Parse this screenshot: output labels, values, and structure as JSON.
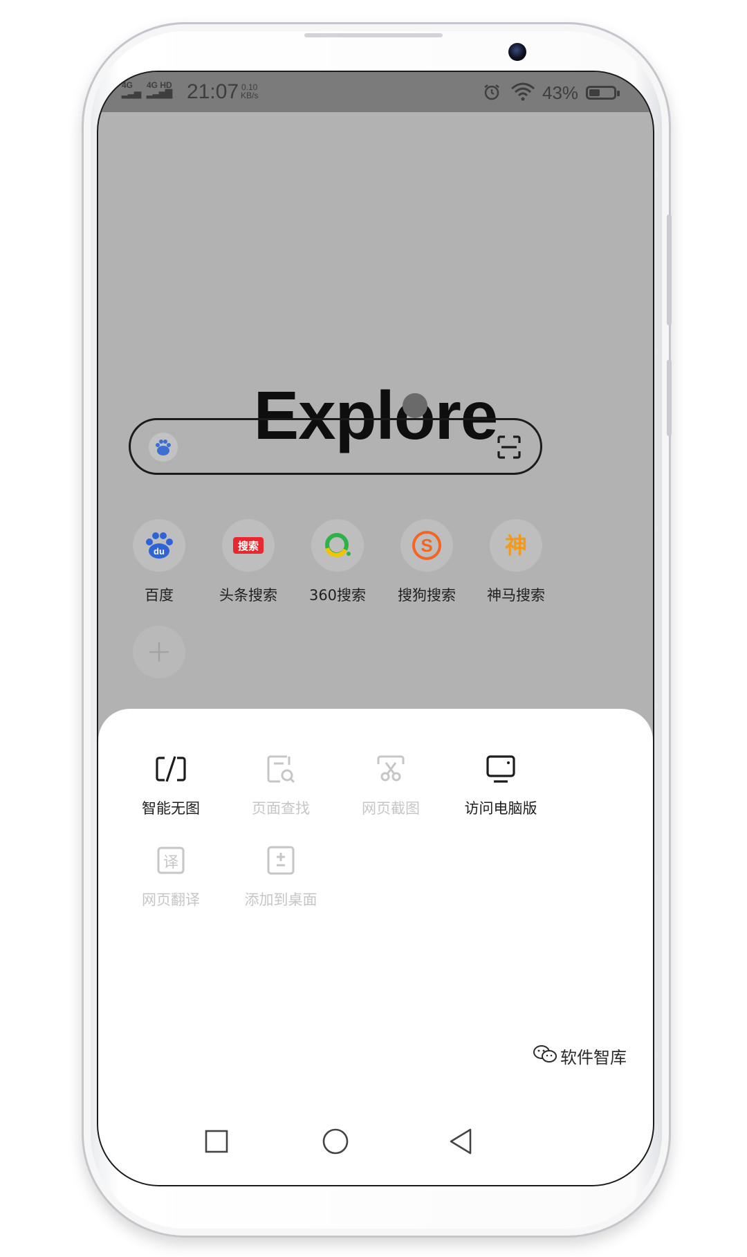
{
  "status_bar": {
    "network_1": "4G",
    "network_2": "4G HD",
    "time": "21:07",
    "speed_value": "0.10",
    "speed_unit": "KB/s",
    "battery_percent": "43%",
    "battery_level": 0.43
  },
  "home": {
    "logo_text": "Explore",
    "search": {
      "engine_icon": "baidu-paw-icon",
      "scan_icon": "scan-icon"
    },
    "shortcuts": [
      {
        "label": "百度",
        "icon": "baidu-icon",
        "icon_text": "du",
        "color": "#2f64d8"
      },
      {
        "label": "头条搜索",
        "icon": "toutiao-search-icon",
        "icon_text": "搜索",
        "color": "#e8272f"
      },
      {
        "label": "360搜索",
        "icon": "360-search-icon",
        "icon_text": "",
        "color": "#2fb14a"
      },
      {
        "label": "搜狗搜索",
        "icon": "sogou-search-icon",
        "icon_text": "S",
        "color": "#f26522"
      },
      {
        "label": "神马搜索",
        "icon": "shenma-search-icon",
        "icon_text": "神",
        "color": "#f29a1a"
      }
    ],
    "add_shortcut_icon": "plus-icon"
  },
  "menu_sheet": {
    "items": [
      {
        "label": "智能无图",
        "icon": "no-image-icon",
        "enabled": true
      },
      {
        "label": "页面查找",
        "icon": "page-find-icon",
        "enabled": false
      },
      {
        "label": "网页截图",
        "icon": "screenshot-scissors-icon",
        "enabled": false
      },
      {
        "label": "访问电脑版",
        "icon": "desktop-site-icon",
        "enabled": true
      },
      {
        "label": "网页翻译",
        "icon": "translate-icon",
        "icon_text": "译",
        "enabled": false
      },
      {
        "label": "添加到桌面",
        "icon": "add-to-desktop-icon",
        "enabled": false
      }
    ]
  },
  "nav_bar": {
    "recent": "recent-apps-icon",
    "home": "home-icon",
    "back": "back-icon"
  },
  "watermark": {
    "text": "软件智库",
    "icon": "wechat-icon"
  },
  "colors": {
    "overlay": "#b2b2b2",
    "sheet": "#ffffff",
    "disabled_text": "#c6c6c6"
  }
}
